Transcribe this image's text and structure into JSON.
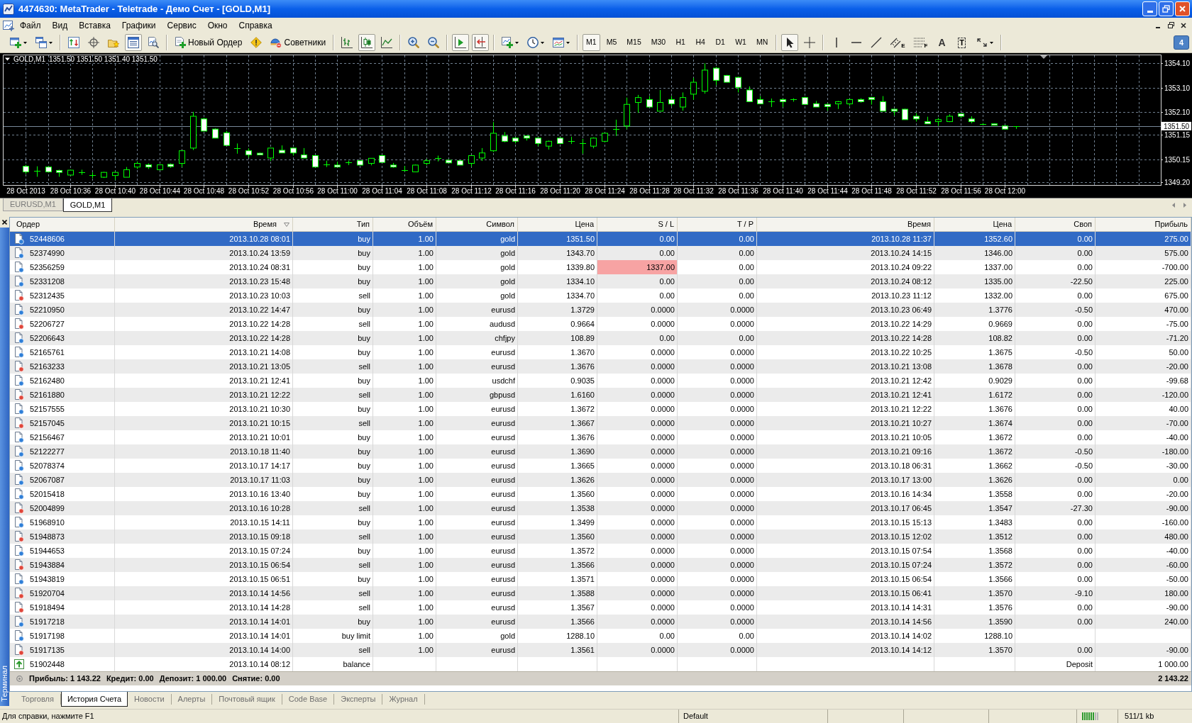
{
  "window": {
    "title": "4474630: MetaTrader - Teletrade - Демо Счет - [GOLD,M1]"
  },
  "menu": [
    "Файл",
    "Вид",
    "Вставка",
    "Графики",
    "Сервис",
    "Окно",
    "Справка"
  ],
  "toolbar": {
    "groups": [
      [
        {
          "kind": "new-chart",
          "pressed": false
        },
        {
          "kind": "profiles",
          "pressed": false
        }
      ],
      [
        {
          "kind": "market-watch",
          "pressed": false
        },
        {
          "kind": "data-window",
          "pressed": false
        },
        {
          "kind": "navigator",
          "pressed": false
        },
        {
          "kind": "terminal",
          "pressed": true
        },
        {
          "kind": "tester",
          "pressed": false
        }
      ],
      [
        {
          "kind": "new-order",
          "label": "Новый Ордер",
          "pressed": false
        },
        {
          "kind": "metaeditor",
          "pressed": false
        },
        {
          "kind": "experts",
          "label": "Советники",
          "pressed": false
        }
      ],
      [
        {
          "kind": "bar-chart",
          "pressed": false
        },
        {
          "kind": "candles",
          "pressed": true
        },
        {
          "kind": "line-chart",
          "pressed": false
        }
      ],
      [
        {
          "kind": "zoom-in",
          "pressed": false
        },
        {
          "kind": "zoom-out",
          "pressed": false
        }
      ],
      [
        {
          "kind": "autoscroll",
          "pressed": true
        },
        {
          "kind": "chart-shift",
          "pressed": true
        }
      ],
      [
        {
          "kind": "indicators",
          "pressed": false
        },
        {
          "kind": "periods",
          "pressed": false
        },
        {
          "kind": "templates",
          "pressed": false
        }
      ],
      [
        {
          "kind": "period",
          "label": "M1",
          "pressed": true
        },
        {
          "kind": "period",
          "label": "M5",
          "pressed": false
        },
        {
          "kind": "period",
          "label": "M15",
          "pressed": false
        },
        {
          "kind": "period",
          "label": "M30",
          "pressed": false
        },
        {
          "kind": "period",
          "label": "H1",
          "pressed": false
        },
        {
          "kind": "period",
          "label": "H4",
          "pressed": false
        },
        {
          "kind": "period",
          "label": "D1",
          "pressed": false
        },
        {
          "kind": "period",
          "label": "W1",
          "pressed": false
        },
        {
          "kind": "period",
          "label": "MN",
          "pressed": false
        }
      ],
      [
        {
          "kind": "cursor",
          "pressed": true
        },
        {
          "kind": "crosshair",
          "pressed": false
        }
      ],
      [
        {
          "kind": "vline",
          "pressed": false
        },
        {
          "kind": "hline",
          "pressed": false
        },
        {
          "kind": "trendline",
          "pressed": false
        },
        {
          "kind": "channel",
          "label": "E",
          "pressed": false
        },
        {
          "kind": "fibo",
          "label": "F",
          "pressed": false
        },
        {
          "kind": "text",
          "label": "A",
          "pressed": false
        },
        {
          "kind": "label",
          "label": "T",
          "pressed": false
        },
        {
          "kind": "arrows",
          "pressed": false
        }
      ]
    ],
    "messages": "4"
  },
  "chart": {
    "chart_data": {
      "type": "candlestick",
      "title": "GOLD,M1",
      "subtitle": "1351.50 1351.50 1351.40 1351.50",
      "color": "#00ff00",
      "grid": true,
      "xlim": [
        "2013-10-28T10:30",
        "2013-10-28T12:14"
      ],
      "ylim": [
        1349.09,
        1354.43
      ],
      "yticks": [
        {
          "value": 1349.2,
          "label": "1349.20"
        },
        {
          "value": 1350.15,
          "label": "1350.15"
        },
        {
          "value": 1351.15,
          "label": "1351.15"
        },
        {
          "value": 1352.1,
          "label": "1352.10"
        },
        {
          "value": 1353.1,
          "label": "1353.10"
        },
        {
          "value": 1354.1,
          "label": "1354.10"
        }
      ],
      "xticks": [
        {
          "value": "2013-10-28T10:32",
          "label": "28 Oct 2013"
        },
        {
          "value": "2013-10-28T10:36",
          "label": "28 Oct 10:36"
        },
        {
          "value": "2013-10-28T10:40",
          "label": "28 Oct 10:40"
        },
        {
          "value": "2013-10-28T10:44",
          "label": "28 Oct 10:44"
        },
        {
          "value": "2013-10-28T10:48",
          "label": "28 Oct 10:48"
        },
        {
          "value": "2013-10-28T10:52",
          "label": "28 Oct 10:52"
        },
        {
          "value": "2013-10-28T10:56",
          "label": "28 Oct 10:56"
        },
        {
          "value": "2013-10-28T11:00",
          "label": "28 Oct 11:00"
        },
        {
          "value": "2013-10-28T11:04",
          "label": "28 Oct 11:04"
        },
        {
          "value": "2013-10-28T11:08",
          "label": "28 Oct 11:08"
        },
        {
          "value": "2013-10-28T11:12",
          "label": "28 Oct 11:12"
        },
        {
          "value": "2013-10-28T11:16",
          "label": "28 Oct 11:16"
        },
        {
          "value": "2013-10-28T11:20",
          "label": "28 Oct 11:20"
        },
        {
          "value": "2013-10-28T11:24",
          "label": "28 Oct 11:24"
        },
        {
          "value": "2013-10-28T11:28",
          "label": "28 Oct 11:28"
        },
        {
          "value": "2013-10-28T11:32",
          "label": "28 Oct 11:32"
        },
        {
          "value": "2013-10-28T11:36",
          "label": "28 Oct 11:36"
        },
        {
          "value": "2013-10-28T11:40",
          "label": "28 Oct 11:40"
        },
        {
          "value": "2013-10-28T11:44",
          "label": "28 Oct 11:44"
        },
        {
          "value": "2013-10-28T11:48",
          "label": "28 Oct 11:48"
        },
        {
          "value": "2013-10-28T11:52",
          "label": "28 Oct 11:52"
        },
        {
          "value": "2013-10-28T11:56",
          "label": "28 Oct 11:56"
        },
        {
          "value": "2013-10-28T12:00",
          "label": "28 Oct 12:00"
        }
      ],
      "ref_lines": [
        {
          "axis": "y",
          "value": 1351.5,
          "label": "1351.50",
          "color": "#778899"
        }
      ],
      "x": [
        "2013-10-28T10:32",
        "2013-10-28T10:33",
        "2013-10-28T10:34",
        "2013-10-28T10:35",
        "2013-10-28T10:36",
        "2013-10-28T10:37",
        "2013-10-28T10:38",
        "2013-10-28T10:39",
        "2013-10-28T10:40",
        "2013-10-28T10:41",
        "2013-10-28T10:42",
        "2013-10-28T10:43",
        "2013-10-28T10:44",
        "2013-10-28T10:45",
        "2013-10-28T10:46",
        "2013-10-28T10:47",
        "2013-10-28T10:48",
        "2013-10-28T10:49",
        "2013-10-28T10:50",
        "2013-10-28T10:51",
        "2013-10-28T10:52",
        "2013-10-28T10:53",
        "2013-10-28T10:54",
        "2013-10-28T10:55",
        "2013-10-28T10:56",
        "2013-10-28T10:57",
        "2013-10-28T10:58",
        "2013-10-28T10:59",
        "2013-10-28T11:00",
        "2013-10-28T11:01",
        "2013-10-28T11:02",
        "2013-10-28T11:03",
        "2013-10-28T11:04",
        "2013-10-28T11:05",
        "2013-10-28T11:06",
        "2013-10-28T11:07",
        "2013-10-28T11:08",
        "2013-10-28T11:09",
        "2013-10-28T11:10",
        "2013-10-28T11:11",
        "2013-10-28T11:12",
        "2013-10-28T11:13",
        "2013-10-28T11:14",
        "2013-10-28T11:15",
        "2013-10-28T11:16",
        "2013-10-28T11:17",
        "2013-10-28T11:18",
        "2013-10-28T11:19",
        "2013-10-28T11:20",
        "2013-10-28T11:21",
        "2013-10-28T11:22",
        "2013-10-28T11:23",
        "2013-10-28T11:24",
        "2013-10-28T11:25",
        "2013-10-28T11:26",
        "2013-10-28T11:27",
        "2013-10-28T11:28",
        "2013-10-28T11:29",
        "2013-10-28T11:30",
        "2013-10-28T11:31",
        "2013-10-28T11:32",
        "2013-10-28T11:33",
        "2013-10-28T11:34",
        "2013-10-28T11:35",
        "2013-10-28T11:36",
        "2013-10-28T11:37",
        "2013-10-28T11:38",
        "2013-10-28T11:39",
        "2013-10-28T11:40",
        "2013-10-28T11:41",
        "2013-10-28T11:42",
        "2013-10-28T11:43",
        "2013-10-28T11:44",
        "2013-10-28T11:45",
        "2013-10-28T11:46",
        "2013-10-28T11:47",
        "2013-10-28T11:48",
        "2013-10-28T11:49",
        "2013-10-28T11:50",
        "2013-10-28T11:51",
        "2013-10-28T11:52",
        "2013-10-28T11:53",
        "2013-10-28T11:54",
        "2013-10-28T11:55",
        "2013-10-28T11:56",
        "2013-10-28T11:57",
        "2013-10-28T11:58",
        "2013-10-28T11:59",
        "2013-10-28T12:00",
        "2013-10-28T12:01"
      ],
      "ohlc": [
        [
          1349.86,
          1349.92,
          1349.55,
          1349.63
        ],
        [
          1349.67,
          1349.86,
          1349.43,
          1349.67
        ],
        [
          1349.83,
          1349.86,
          1349.6,
          1349.63
        ],
        [
          1349.69,
          1349.72,
          1349.43,
          1349.61
        ],
        [
          1349.5,
          1349.72,
          1349.48,
          1349.7
        ],
        [
          1349.62,
          1349.72,
          1349.51,
          1349.62
        ],
        [
          1349.5,
          1349.61,
          1349.37,
          1349.5
        ],
        [
          1349.41,
          1349.63,
          1349.38,
          1349.61
        ],
        [
          1349.48,
          1349.64,
          1349.3,
          1349.61
        ],
        [
          1349.41,
          1349.83,
          1349.41,
          1349.72
        ],
        [
          1349.83,
          1350.06,
          1349.75,
          1349.98
        ],
        [
          1349.92,
          1349.98,
          1349.75,
          1349.83
        ],
        [
          1349.72,
          1349.94,
          1349.7,
          1349.92
        ],
        [
          1349.94,
          1349.98,
          1349.8,
          1349.85
        ],
        [
          1349.98,
          1350.5,
          1349.83,
          1350.5
        ],
        [
          1350.61,
          1352.1,
          1350.53,
          1351.92
        ],
        [
          1351.81,
          1351.85,
          1351.31,
          1351.31
        ],
        [
          1351.39,
          1351.42,
          1351.02,
          1351.02
        ],
        [
          1351.24,
          1351.32,
          1350.72,
          1350.72
        ],
        [
          1350.61,
          1350.8,
          1350.38,
          1350.61
        ],
        [
          1350.5,
          1350.6,
          1350.22,
          1350.33
        ],
        [
          1350.4,
          1350.42,
          1350.33,
          1350.33
        ],
        [
          1350.2,
          1350.61,
          1350.08,
          1350.61
        ],
        [
          1350.52,
          1350.72,
          1350.41,
          1350.41
        ],
        [
          1350.61,
          1350.63,
          1350.3,
          1350.41
        ],
        [
          1350.33,
          1350.61,
          1350.2,
          1350.2
        ],
        [
          1350.3,
          1350.3,
          1349.83,
          1349.83
        ],
        [
          1349.95,
          1350.09,
          1349.83,
          1349.95
        ],
        [
          1349.91,
          1350.05,
          1349.83,
          1349.83
        ],
        [
          1350.02,
          1350.09,
          1349.91,
          1350.02
        ],
        [
          1350.09,
          1350.12,
          1349.91,
          1349.91
        ],
        [
          1349.98,
          1350.19,
          1349.9,
          1350.19
        ],
        [
          1350.3,
          1350.33,
          1350.02,
          1350.02
        ],
        [
          1349.91,
          1350.0,
          1349.8,
          1349.83
        ],
        [
          1349.7,
          1349.87,
          1349.64,
          1349.7
        ],
        [
          1349.63,
          1349.93,
          1349.63,
          1349.91
        ],
        [
          1349.98,
          1350.16,
          1349.9,
          1350.09
        ],
        [
          1350.19,
          1350.3,
          1350.06,
          1350.19
        ],
        [
          1350.11,
          1350.14,
          1350.0,
          1350.0
        ],
        [
          1350.09,
          1350.11,
          1349.91,
          1349.91
        ],
        [
          1349.98,
          1350.3,
          1349.85,
          1350.3
        ],
        [
          1350.2,
          1350.61,
          1350.08,
          1350.41
        ],
        [
          1350.5,
          1351.68,
          1350.45,
          1351.22
        ],
        [
          1351.11,
          1351.27,
          1350.85,
          1350.89
        ],
        [
          1351.02,
          1351.05,
          1350.8,
          1350.89
        ],
        [
          1351.11,
          1351.14,
          1350.92,
          1351.02
        ],
        [
          1351.02,
          1351.05,
          1350.69,
          1350.8
        ],
        [
          1350.69,
          1350.92,
          1350.55,
          1350.89
        ],
        [
          1351.02,
          1351.05,
          1350.78,
          1350.8
        ],
        [
          1350.89,
          1351.08,
          1350.78,
          1350.89
        ],
        [
          1350.8,
          1350.99,
          1350.38,
          1350.8
        ],
        [
          1350.69,
          1351.05,
          1350.6,
          1351.02
        ],
        [
          1350.89,
          1351.24,
          1350.85,
          1351.22
        ],
        [
          1351.39,
          1351.78,
          1351.11,
          1351.39
        ],
        [
          1351.52,
          1352.69,
          1351.39,
          1352.41
        ],
        [
          1352.49,
          1352.8,
          1352.06,
          1352.69
        ],
        [
          1352.61,
          1352.75,
          1352.3,
          1352.3
        ],
        [
          1352.13,
          1353.0,
          1352.13,
          1352.49
        ],
        [
          1352.61,
          1352.75,
          1352.33,
          1352.43
        ],
        [
          1352.3,
          1352.9,
          1352.15,
          1352.69
        ],
        [
          1352.83,
          1353.5,
          1352.6,
          1353.32
        ],
        [
          1352.95,
          1354.1,
          1352.85,
          1353.82
        ],
        [
          1353.9,
          1353.95,
          1353.2,
          1353.4
        ],
        [
          1353.6,
          1353.62,
          1353.32,
          1353.32
        ],
        [
          1353.52,
          1353.55,
          1352.9,
          1353.11
        ],
        [
          1353.0,
          1353.15,
          1352.52,
          1352.52
        ],
        [
          1352.61,
          1352.75,
          1352.43,
          1352.43
        ],
        [
          1352.52,
          1352.65,
          1352.3,
          1352.52
        ],
        [
          1352.61,
          1352.65,
          1352.3,
          1352.52
        ],
        [
          1352.61,
          1352.66,
          1352.52,
          1352.61
        ],
        [
          1352.69,
          1352.72,
          1352.41,
          1352.41
        ],
        [
          1352.44,
          1352.55,
          1352.3,
          1352.3
        ],
        [
          1352.41,
          1352.45,
          1352.15,
          1352.32
        ],
        [
          1352.43,
          1352.55,
          1352.22,
          1352.52
        ],
        [
          1352.43,
          1352.63,
          1352.35,
          1352.61
        ],
        [
          1352.61,
          1352.66,
          1352.48,
          1352.52
        ],
        [
          1352.69,
          1352.72,
          1352.4,
          1352.61
        ],
        [
          1352.52,
          1352.75,
          1352.13,
          1352.13
        ],
        [
          1352.21,
          1352.23,
          1351.95,
          1352.13
        ],
        [
          1352.21,
          1352.23,
          1351.78,
          1351.78
        ],
        [
          1351.92,
          1352.05,
          1351.7,
          1351.81
        ],
        [
          1351.7,
          1351.9,
          1351.61,
          1351.61
        ],
        [
          1351.7,
          1351.85,
          1351.52,
          1351.78
        ],
        [
          1351.7,
          1352.0,
          1351.68,
          1351.92
        ],
        [
          1352.02,
          1352.05,
          1351.85,
          1351.92
        ],
        [
          1351.81,
          1351.92,
          1351.63,
          1351.7
        ],
        [
          1351.61,
          1351.64,
          1351.58,
          1351.61
        ],
        [
          1351.61,
          1351.63,
          1351.55,
          1351.55
        ],
        [
          1351.52,
          1351.55,
          1351.39,
          1351.39
        ],
        [
          1351.5,
          1351.5,
          1351.4,
          1351.5
        ]
      ]
    }
  },
  "chart_tabs": [
    {
      "label": "EURUSD,M1",
      "selected": false
    },
    {
      "label": "GOLD,M1",
      "selected": true
    }
  ],
  "terminal": {
    "label": "Терминал",
    "columns": [
      {
        "label": "Ордер",
        "sorted": false
      },
      {
        "label": "Время",
        "sorted": true
      },
      {
        "label": "Тип",
        "sorted": false
      },
      {
        "label": "Объём",
        "sorted": false
      },
      {
        "label": "Символ",
        "sorted": false
      },
      {
        "label": "Цена",
        "sorted": false
      },
      {
        "label": "S / L",
        "sorted": false
      },
      {
        "label": "T / P",
        "sorted": false
      },
      {
        "label": "Время",
        "sorted": false
      },
      {
        "label": "Цена",
        "sorted": false
      },
      {
        "label": "Своп",
        "sorted": false
      },
      {
        "label": "Прибыль",
        "sorted": false
      }
    ],
    "rows": [
      {
        "kind": "buy",
        "selected": true,
        "sl_hit": false,
        "order": "52448606",
        "time": "2013.10.28 08:01",
        "type": "buy",
        "volume": "1.00",
        "symbol": "gold",
        "price": "1351.50",
        "sl": "0.00",
        "tp": "0.00",
        "close_time": "2013.10.28 11:37",
        "close_price": "1352.60",
        "swap": "0.00",
        "profit": "275.00"
      },
      {
        "kind": "buy",
        "selected": false,
        "sl_hit": false,
        "order": "52374990",
        "time": "2013.10.24 13:59",
        "type": "buy",
        "volume": "1.00",
        "symbol": "gold",
        "price": "1343.70",
        "sl": "0.00",
        "tp": "0.00",
        "close_time": "2013.10.24 14:15",
        "close_price": "1346.00",
        "swap": "0.00",
        "profit": "575.00"
      },
      {
        "kind": "buy",
        "selected": false,
        "sl_hit": true,
        "order": "52356259",
        "time": "2013.10.24 08:31",
        "type": "buy",
        "volume": "1.00",
        "symbol": "gold",
        "price": "1339.80",
        "sl": "1337.00",
        "tp": "0.00",
        "close_time": "2013.10.24 09:22",
        "close_price": "1337.00",
        "swap": "0.00",
        "profit": "-700.00"
      },
      {
        "kind": "buy",
        "selected": false,
        "sl_hit": false,
        "order": "52331208",
        "time": "2013.10.23 15:48",
        "type": "buy",
        "volume": "1.00",
        "symbol": "gold",
        "price": "1334.10",
        "sl": "0.00",
        "tp": "0.00",
        "close_time": "2013.10.24 08:12",
        "close_price": "1335.00",
        "swap": "-22.50",
        "profit": "225.00"
      },
      {
        "kind": "sell",
        "selected": false,
        "sl_hit": false,
        "order": "52312435",
        "time": "2013.10.23 10:03",
        "type": "sell",
        "volume": "1.00",
        "symbol": "gold",
        "price": "1334.70",
        "sl": "0.00",
        "tp": "0.00",
        "close_time": "2013.10.23 11:12",
        "close_price": "1332.00",
        "swap": "0.00",
        "profit": "675.00"
      },
      {
        "kind": "buy",
        "selected": false,
        "sl_hit": false,
        "order": "52210950",
        "time": "2013.10.22 14:47",
        "type": "buy",
        "volume": "1.00",
        "symbol": "eurusd",
        "price": "1.3729",
        "sl": "0.0000",
        "tp": "0.0000",
        "close_time": "2013.10.23 06:49",
        "close_price": "1.3776",
        "swap": "-0.50",
        "profit": "470.00"
      },
      {
        "kind": "sell",
        "selected": false,
        "sl_hit": false,
        "order": "52206727",
        "time": "2013.10.22 14:28",
        "type": "sell",
        "volume": "1.00",
        "symbol": "audusd",
        "price": "0.9664",
        "sl": "0.0000",
        "tp": "0.0000",
        "close_time": "2013.10.22 14:29",
        "close_price": "0.9669",
        "swap": "0.00",
        "profit": "-75.00"
      },
      {
        "kind": "buy",
        "selected": false,
        "sl_hit": false,
        "order": "52206643",
        "time": "2013.10.22 14:28",
        "type": "buy",
        "volume": "1.00",
        "symbol": "chfjpy",
        "price": "108.89",
        "sl": "0.00",
        "tp": "0.00",
        "close_time": "2013.10.22 14:28",
        "close_price": "108.82",
        "swap": "0.00",
        "profit": "-71.20"
      },
      {
        "kind": "buy",
        "selected": false,
        "sl_hit": false,
        "order": "52165761",
        "time": "2013.10.21 14:08",
        "type": "buy",
        "volume": "1.00",
        "symbol": "eurusd",
        "price": "1.3670",
        "sl": "0.0000",
        "tp": "0.0000",
        "close_time": "2013.10.22 10:25",
        "close_price": "1.3675",
        "swap": "-0.50",
        "profit": "50.00"
      },
      {
        "kind": "sell",
        "selected": false,
        "sl_hit": false,
        "order": "52163233",
        "time": "2013.10.21 13:05",
        "type": "sell",
        "volume": "1.00",
        "symbol": "eurusd",
        "price": "1.3676",
        "sl": "0.0000",
        "tp": "0.0000",
        "close_time": "2013.10.21 13:08",
        "close_price": "1.3678",
        "swap": "0.00",
        "profit": "-20.00"
      },
      {
        "kind": "buy",
        "selected": false,
        "sl_hit": false,
        "order": "52162480",
        "time": "2013.10.21 12:41",
        "type": "buy",
        "volume": "1.00",
        "symbol": "usdchf",
        "price": "0.9035",
        "sl": "0.0000",
        "tp": "0.0000",
        "close_time": "2013.10.21 12:42",
        "close_price": "0.9029",
        "swap": "0.00",
        "profit": "-99.68"
      },
      {
        "kind": "sell",
        "selected": false,
        "sl_hit": false,
        "order": "52161880",
        "time": "2013.10.21 12:22",
        "type": "sell",
        "volume": "1.00",
        "symbol": "gbpusd",
        "price": "1.6160",
        "sl": "0.0000",
        "tp": "0.0000",
        "close_time": "2013.10.21 12:41",
        "close_price": "1.6172",
        "swap": "0.00",
        "profit": "-120.00"
      },
      {
        "kind": "buy",
        "selected": false,
        "sl_hit": false,
        "order": "52157555",
        "time": "2013.10.21 10:30",
        "type": "buy",
        "volume": "1.00",
        "symbol": "eurusd",
        "price": "1.3672",
        "sl": "0.0000",
        "tp": "0.0000",
        "close_time": "2013.10.21 12:22",
        "close_price": "1.3676",
        "swap": "0.00",
        "profit": "40.00"
      },
      {
        "kind": "sell",
        "selected": false,
        "sl_hit": false,
        "order": "52157045",
        "time": "2013.10.21 10:15",
        "type": "sell",
        "volume": "1.00",
        "symbol": "eurusd",
        "price": "1.3667",
        "sl": "0.0000",
        "tp": "0.0000",
        "close_time": "2013.10.21 10:27",
        "close_price": "1.3674",
        "swap": "0.00",
        "profit": "-70.00"
      },
      {
        "kind": "buy",
        "selected": false,
        "sl_hit": false,
        "order": "52156467",
        "time": "2013.10.21 10:01",
        "type": "buy",
        "volume": "1.00",
        "symbol": "eurusd",
        "price": "1.3676",
        "sl": "0.0000",
        "tp": "0.0000",
        "close_time": "2013.10.21 10:05",
        "close_price": "1.3672",
        "swap": "0.00",
        "profit": "-40.00"
      },
      {
        "kind": "buy",
        "selected": false,
        "sl_hit": false,
        "order": "52122277",
        "time": "2013.10.18 11:40",
        "type": "buy",
        "volume": "1.00",
        "symbol": "eurusd",
        "price": "1.3690",
        "sl": "0.0000",
        "tp": "0.0000",
        "close_time": "2013.10.21 09:16",
        "close_price": "1.3672",
        "swap": "-0.50",
        "profit": "-180.00"
      },
      {
        "kind": "buy",
        "selected": false,
        "sl_hit": false,
        "order": "52078374",
        "time": "2013.10.17 14:17",
        "type": "buy",
        "volume": "1.00",
        "symbol": "eurusd",
        "price": "1.3665",
        "sl": "0.0000",
        "tp": "0.0000",
        "close_time": "2013.10.18 06:31",
        "close_price": "1.3662",
        "swap": "-0.50",
        "profit": "-30.00"
      },
      {
        "kind": "buy",
        "selected": false,
        "sl_hit": false,
        "order": "52067087",
        "time": "2013.10.17 11:03",
        "type": "buy",
        "volume": "1.00",
        "symbol": "eurusd",
        "price": "1.3626",
        "sl": "0.0000",
        "tp": "0.0000",
        "close_time": "2013.10.17 13:00",
        "close_price": "1.3626",
        "swap": "0.00",
        "profit": "0.00"
      },
      {
        "kind": "buy",
        "selected": false,
        "sl_hit": false,
        "order": "52015418",
        "time": "2013.10.16 13:40",
        "type": "buy",
        "volume": "1.00",
        "symbol": "eurusd",
        "price": "1.3560",
        "sl": "0.0000",
        "tp": "0.0000",
        "close_time": "2013.10.16 14:34",
        "close_price": "1.3558",
        "swap": "0.00",
        "profit": "-20.00"
      },
      {
        "kind": "sell",
        "selected": false,
        "sl_hit": false,
        "order": "52004899",
        "time": "2013.10.16 10:28",
        "type": "sell",
        "volume": "1.00",
        "symbol": "eurusd",
        "price": "1.3538",
        "sl": "0.0000",
        "tp": "0.0000",
        "close_time": "2013.10.17 06:45",
        "close_price": "1.3547",
        "swap": "-27.30",
        "profit": "-90.00"
      },
      {
        "kind": "buy",
        "selected": false,
        "sl_hit": false,
        "order": "51968910",
        "time": "2013.10.15 14:11",
        "type": "buy",
        "volume": "1.00",
        "symbol": "eurusd",
        "price": "1.3499",
        "sl": "0.0000",
        "tp": "0.0000",
        "close_time": "2013.10.15 15:13",
        "close_price": "1.3483",
        "swap": "0.00",
        "profit": "-160.00"
      },
      {
        "kind": "sell",
        "selected": false,
        "sl_hit": false,
        "order": "51948873",
        "time": "2013.10.15 09:18",
        "type": "sell",
        "volume": "1.00",
        "symbol": "eurusd",
        "price": "1.3560",
        "sl": "0.0000",
        "tp": "0.0000",
        "close_time": "2013.10.15 12:02",
        "close_price": "1.3512",
        "swap": "0.00",
        "profit": "480.00"
      },
      {
        "kind": "buy",
        "selected": false,
        "sl_hit": false,
        "order": "51944653",
        "time": "2013.10.15 07:24",
        "type": "buy",
        "volume": "1.00",
        "symbol": "eurusd",
        "price": "1.3572",
        "sl": "0.0000",
        "tp": "0.0000",
        "close_time": "2013.10.15 07:54",
        "close_price": "1.3568",
        "swap": "0.00",
        "profit": "-40.00"
      },
      {
        "kind": "sell",
        "selected": false,
        "sl_hit": false,
        "order": "51943884",
        "time": "2013.10.15 06:54",
        "type": "sell",
        "volume": "1.00",
        "symbol": "eurusd",
        "price": "1.3566",
        "sl": "0.0000",
        "tp": "0.0000",
        "close_time": "2013.10.15 07:24",
        "close_price": "1.3572",
        "swap": "0.00",
        "profit": "-60.00"
      },
      {
        "kind": "buy",
        "selected": false,
        "sl_hit": false,
        "order": "51943819",
        "time": "2013.10.15 06:51",
        "type": "buy",
        "volume": "1.00",
        "symbol": "eurusd",
        "price": "1.3571",
        "sl": "0.0000",
        "tp": "0.0000",
        "close_time": "2013.10.15 06:54",
        "close_price": "1.3566",
        "swap": "0.00",
        "profit": "-50.00"
      },
      {
        "kind": "sell",
        "selected": false,
        "sl_hit": false,
        "order": "51920704",
        "time": "2013.10.14 14:56",
        "type": "sell",
        "volume": "1.00",
        "symbol": "eurusd",
        "price": "1.3588",
        "sl": "0.0000",
        "tp": "0.0000",
        "close_time": "2013.10.15 06:41",
        "close_price": "1.3570",
        "swap": "-9.10",
        "profit": "180.00"
      },
      {
        "kind": "sell",
        "selected": false,
        "sl_hit": false,
        "order": "51918494",
        "time": "2013.10.14 14:28",
        "type": "sell",
        "volume": "1.00",
        "symbol": "eurusd",
        "price": "1.3567",
        "sl": "0.0000",
        "tp": "0.0000",
        "close_time": "2013.10.14 14:31",
        "close_price": "1.3576",
        "swap": "0.00",
        "profit": "-90.00"
      },
      {
        "kind": "buy",
        "selected": false,
        "sl_hit": false,
        "order": "51917218",
        "time": "2013.10.14 14:01",
        "type": "buy",
        "volume": "1.00",
        "symbol": "eurusd",
        "price": "1.3566",
        "sl": "0.0000",
        "tp": "0.0000",
        "close_time": "2013.10.14 14:56",
        "close_price": "1.3590",
        "swap": "0.00",
        "profit": "240.00"
      },
      {
        "kind": "buy",
        "selected": false,
        "sl_hit": false,
        "order": "51917198",
        "time": "2013.10.14 14:01",
        "type": "buy limit",
        "volume": "1.00",
        "symbol": "gold",
        "price": "1288.10",
        "sl": "0.00",
        "tp": "0.00",
        "close_time": "2013.10.14 14:02",
        "close_price": "1288.10"
      },
      {
        "kind": "sell",
        "selected": false,
        "sl_hit": false,
        "order": "51917135",
        "time": "2013.10.14 14:00",
        "type": "sell",
        "volume": "1.00",
        "symbol": "eurusd",
        "price": "1.3561",
        "sl": "0.0000",
        "tp": "0.0000",
        "close_time": "2013.10.14 14:12",
        "close_price": "1.3570",
        "swap": "0.00",
        "profit": "-90.00"
      },
      {
        "kind": "balance",
        "selected": false,
        "sl_hit": false,
        "order": "51902448",
        "time": "2013.10.14 08:12",
        "type": "balance",
        "comment": "Deposit",
        "profit": "1 000.00"
      }
    ],
    "summary": {
      "items": [
        "Прибыль: 1 143.22",
        "Кредит: 0.00",
        "Депозит: 1 000.00",
        "Снятие: 0.00"
      ],
      "total": "2 143.22"
    },
    "tabs": [
      {
        "label": "Торговля",
        "selected": false
      },
      {
        "label": "История Счета",
        "selected": true
      },
      {
        "label": "Новости",
        "selected": false
      },
      {
        "label": "Алерты",
        "selected": false
      },
      {
        "label": "Почтовый ящик",
        "selected": false
      },
      {
        "label": "Code Base",
        "selected": false
      },
      {
        "label": "Эксперты",
        "selected": false
      },
      {
        "label": "Журнал",
        "selected": false
      }
    ]
  },
  "status_bar": {
    "help": "Для справки, нажмите F1",
    "profile": "Default",
    "traffic": "511/1 kb"
  }
}
